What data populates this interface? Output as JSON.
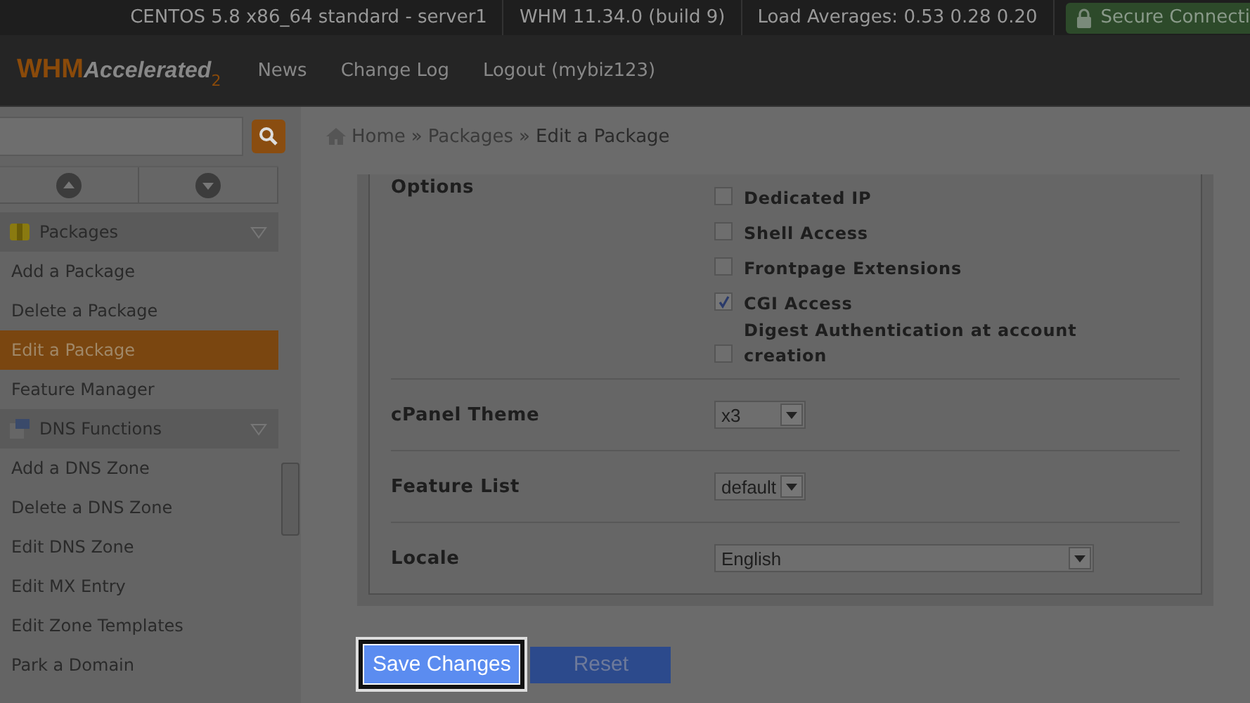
{
  "top_bar": {
    "items": [
      "CENTOS 5.8 x86_64 standard - server1",
      "WHM 11.34.0 (build 9)",
      "Load Averages: 0.53 0.28 0.20"
    ],
    "secure": "Secure Connecti"
  },
  "header": {
    "logo_main": "WHM",
    "logo_script": "Accelerated",
    "logo_version": "2",
    "nav": [
      "News",
      "Change Log",
      "Logout (mybiz123)"
    ]
  },
  "breadcrumb": {
    "separator": "»",
    "items": [
      "Home",
      "Packages",
      "Edit a Package"
    ]
  },
  "sidebar": {
    "groups": [
      {
        "title": "Packages",
        "kind": "packages",
        "items": [
          {
            "label": "Add a Package",
            "selected": false
          },
          {
            "label": "Delete a Package",
            "selected": false
          },
          {
            "label": "Edit a Package",
            "selected": true
          },
          {
            "label": "Feature Manager",
            "selected": false
          }
        ]
      },
      {
        "title": "DNS Functions",
        "kind": "dns",
        "items": [
          {
            "label": "Add a DNS Zone",
            "selected": false
          },
          {
            "label": "Delete a DNS Zone",
            "selected": false
          },
          {
            "label": "Edit DNS Zone",
            "selected": false
          },
          {
            "label": "Edit MX Entry",
            "selected": false
          },
          {
            "label": "Edit Zone Templates",
            "selected": false
          },
          {
            "label": "Park a Domain",
            "selected": false
          }
        ]
      }
    ]
  },
  "form": {
    "options_label": "Options",
    "options": [
      {
        "label": "Dedicated IP",
        "checked": false
      },
      {
        "label": "Shell Access",
        "checked": false
      },
      {
        "label": "Frontpage Extensions",
        "checked": false
      },
      {
        "label": "CGI Access",
        "checked": true
      },
      {
        "label": "Digest Authentication at account creation",
        "checked": false
      }
    ],
    "selects": [
      {
        "label": "cPanel Theme",
        "value": "x3",
        "kind": "short"
      },
      {
        "label": "Feature List",
        "value": "default",
        "kind": "short"
      },
      {
        "label": "Locale",
        "value": "English",
        "kind": "wide"
      }
    ]
  },
  "buttons": [
    {
      "label": "Save Changes",
      "kind": "primary"
    },
    {
      "label": "Reset",
      "kind": "secondary"
    }
  ]
}
